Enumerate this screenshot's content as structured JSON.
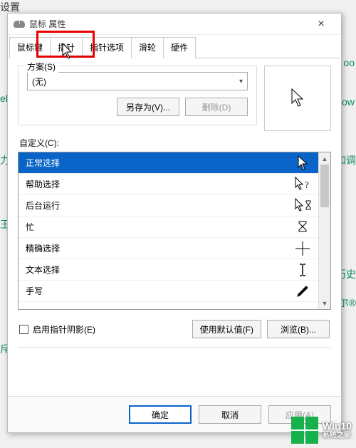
{
  "page_fragments": {
    "top_left": "设置",
    "side1": "ek",
    "side2": "力",
    "side3": "王",
    "side4": "斥",
    "right1": "oo",
    "right2": "ow",
    "right3": "如调",
    "right4": "历史",
    "right5": "尔®"
  },
  "dialog": {
    "title": "鼠标 属性",
    "close": "×"
  },
  "tabs": [
    "鼠标键",
    "指针",
    "指针选项",
    "滑轮",
    "硬件"
  ],
  "scheme": {
    "label": "方案(S)",
    "selected": "(无)",
    "save_as": "另存为(V)...",
    "delete": "删除(D)"
  },
  "customize_label": "自定义(C):",
  "cursors": [
    {
      "label": "正常选择",
      "icon": "arrow-white"
    },
    {
      "label": "帮助选择",
      "icon": "arrow-help"
    },
    {
      "label": "后台运行",
      "icon": "arrow-busy"
    },
    {
      "label": "忙",
      "icon": "hourglass"
    },
    {
      "label": "精确选择",
      "icon": "crosshair"
    },
    {
      "label": "文本选择",
      "icon": "ibeam"
    },
    {
      "label": "手写",
      "icon": "pen"
    }
  ],
  "shadow": {
    "label": "启用指针阴影(E)",
    "defaults": "使用默认值(F)",
    "browse": "浏览(B)..."
  },
  "footer": {
    "ok": "确定",
    "cancel": "取消",
    "apply": "应用(A)"
  },
  "watermark": {
    "line1": "Win10",
    "line2": "系统之家"
  }
}
